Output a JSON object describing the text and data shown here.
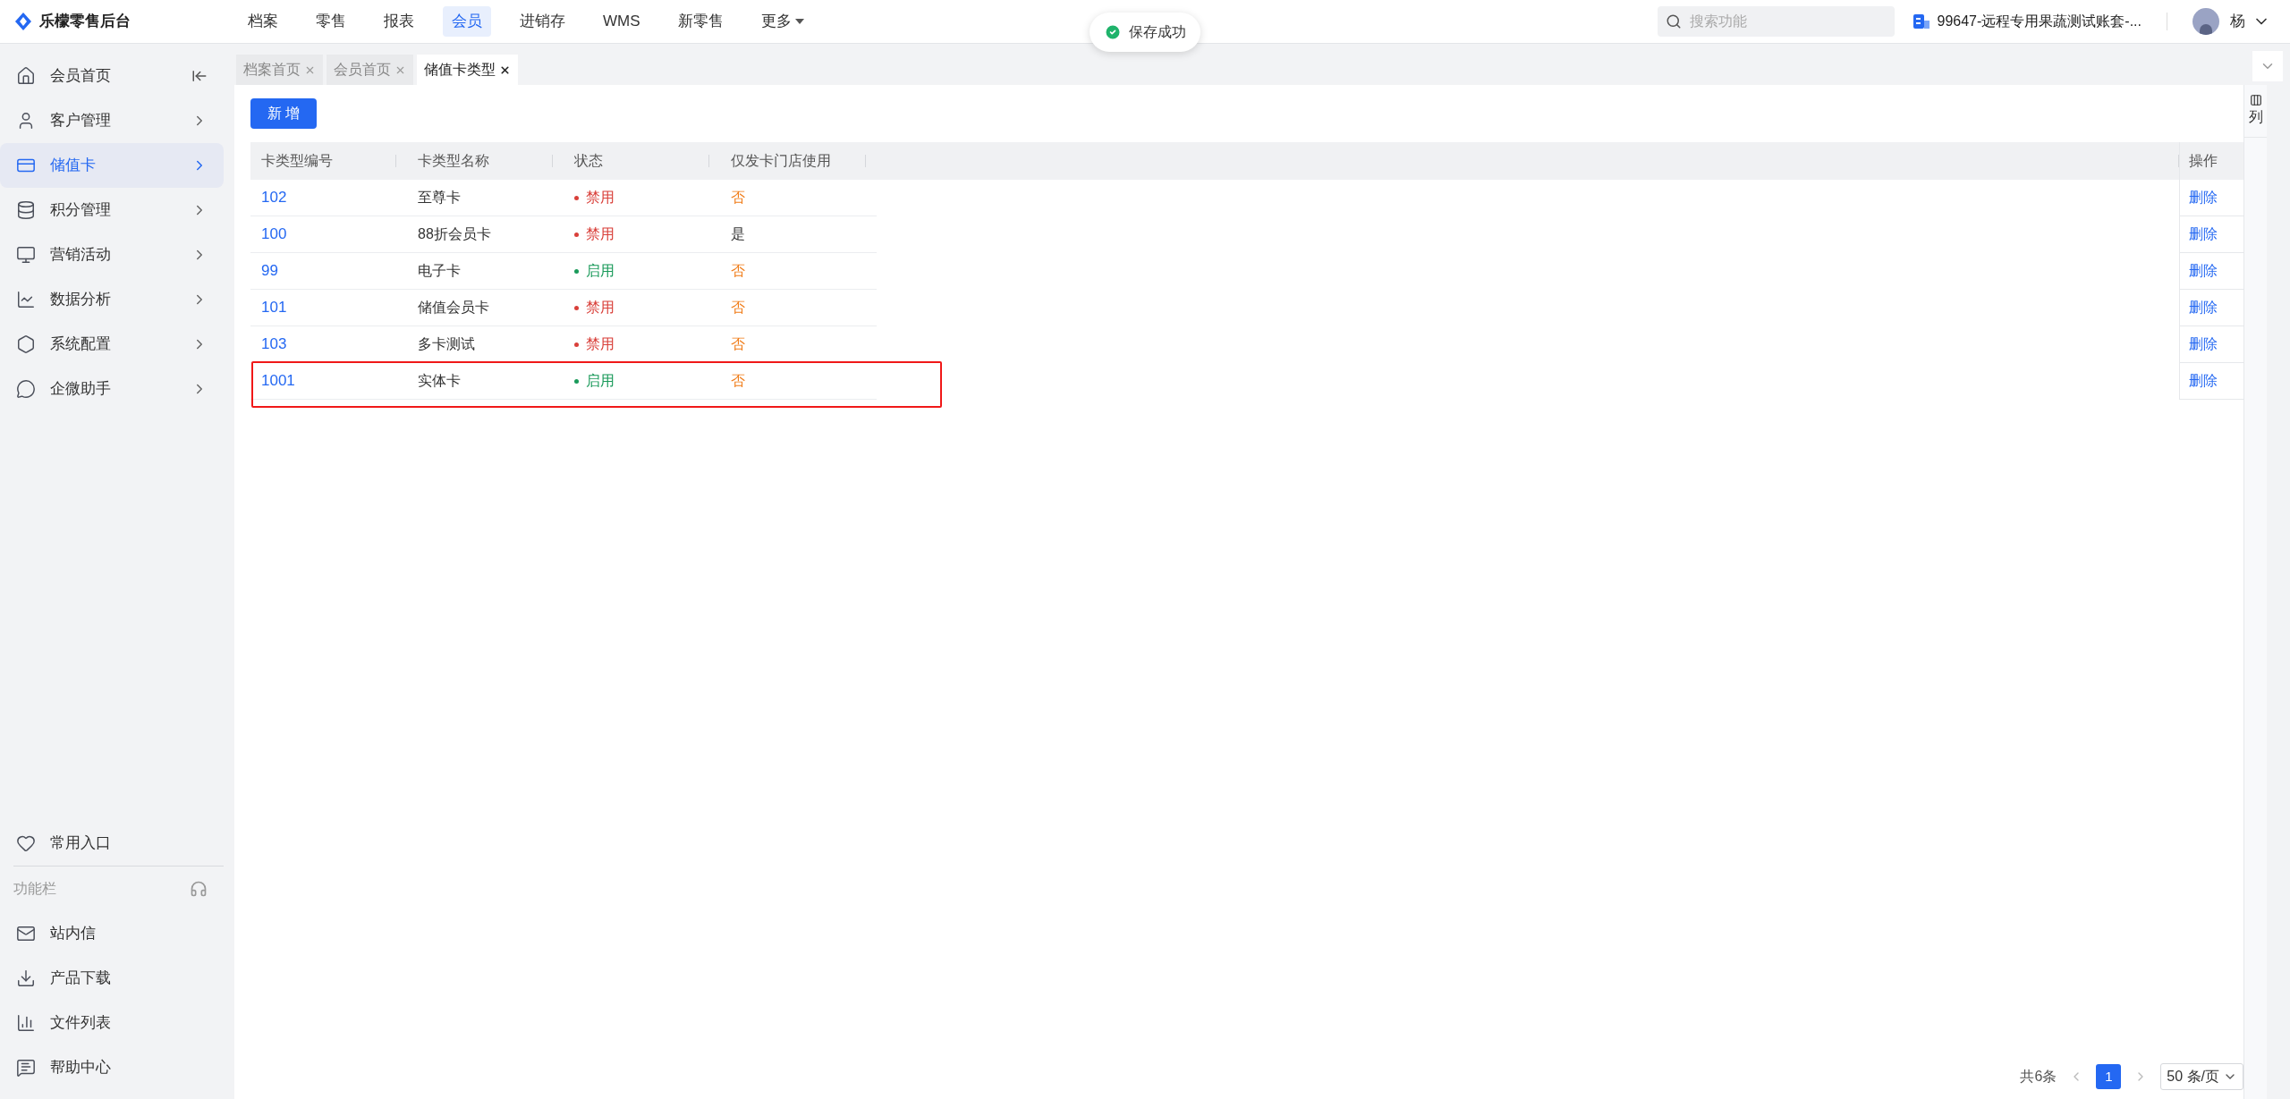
{
  "app": {
    "title": "乐檬零售后台"
  },
  "top_nav": [
    {
      "label": "档案",
      "selected": false
    },
    {
      "label": "零售",
      "selected": false
    },
    {
      "label": "报表",
      "selected": false
    },
    {
      "label": "会员",
      "selected": true
    },
    {
      "label": "进销存",
      "selected": false
    },
    {
      "label": "WMS",
      "selected": false
    },
    {
      "label": "新零售",
      "selected": false
    },
    {
      "label": "更多",
      "selected": false,
      "dropdown": true
    }
  ],
  "toast": {
    "text": "保存成功"
  },
  "search": {
    "placeholder": "搜索功能"
  },
  "account": {
    "name": "99647-远程专用果蔬测试账套-..."
  },
  "user": {
    "name": "杨"
  },
  "sidebar": {
    "items": [
      {
        "label": "会员首页",
        "selected": false
      },
      {
        "label": "客户管理",
        "selected": false
      },
      {
        "label": "储值卡",
        "selected": true
      },
      {
        "label": "积分管理",
        "selected": false
      },
      {
        "label": "营销活动",
        "selected": false
      },
      {
        "label": "数据分析",
        "selected": false
      },
      {
        "label": "系统配置",
        "selected": false
      },
      {
        "label": "企微助手",
        "selected": false
      }
    ],
    "favorites": {
      "label": "常用入口"
    },
    "section_title": "功能栏",
    "tools": [
      {
        "label": "站内信"
      },
      {
        "label": "产品下载"
      },
      {
        "label": "文件列表"
      },
      {
        "label": "帮助中心"
      }
    ]
  },
  "tabs": [
    {
      "label": "档案首页",
      "selected": false
    },
    {
      "label": "会员首页",
      "selected": false
    },
    {
      "label": "储值卡类型",
      "selected": true
    }
  ],
  "add_button": "新 增",
  "table": {
    "columns": [
      "卡类型编号",
      "卡类型名称",
      "状态",
      "仅发卡门店使用"
    ],
    "action_column": "操作",
    "column_settings": "列",
    "rows": [
      {
        "code": "102",
        "name": "至尊卡",
        "status": {
          "text": "禁用",
          "kind": "disabled"
        },
        "store_only": {
          "text": "否",
          "warn": true
        },
        "action": "删除",
        "highlighted": false
      },
      {
        "code": "100",
        "name": "88折会员卡",
        "status": {
          "text": "禁用",
          "kind": "disabled"
        },
        "store_only": {
          "text": "是",
          "warn": false
        },
        "action": "删除",
        "highlighted": false
      },
      {
        "code": "99",
        "name": "电子卡",
        "status": {
          "text": "启用",
          "kind": "enabled"
        },
        "store_only": {
          "text": "否",
          "warn": true
        },
        "action": "删除",
        "highlighted": false
      },
      {
        "code": "101",
        "name": "储值会员卡",
        "status": {
          "text": "禁用",
          "kind": "disabled"
        },
        "store_only": {
          "text": "否",
          "warn": true
        },
        "action": "删除",
        "highlighted": false
      },
      {
        "code": "103",
        "name": "多卡测试",
        "status": {
          "text": "禁用",
          "kind": "disabled"
        },
        "store_only": {
          "text": "否",
          "warn": true
        },
        "action": "删除",
        "highlighted": false
      },
      {
        "code": "1001",
        "name": "实体卡",
        "status": {
          "text": "启用",
          "kind": "enabled"
        },
        "store_only": {
          "text": "否",
          "warn": true
        },
        "action": "删除",
        "highlighted": true
      }
    ]
  },
  "pagination": {
    "total": "共6条",
    "pages": [
      {
        "label": "1",
        "selected": true
      }
    ],
    "page_size": "50 条/页"
  }
}
